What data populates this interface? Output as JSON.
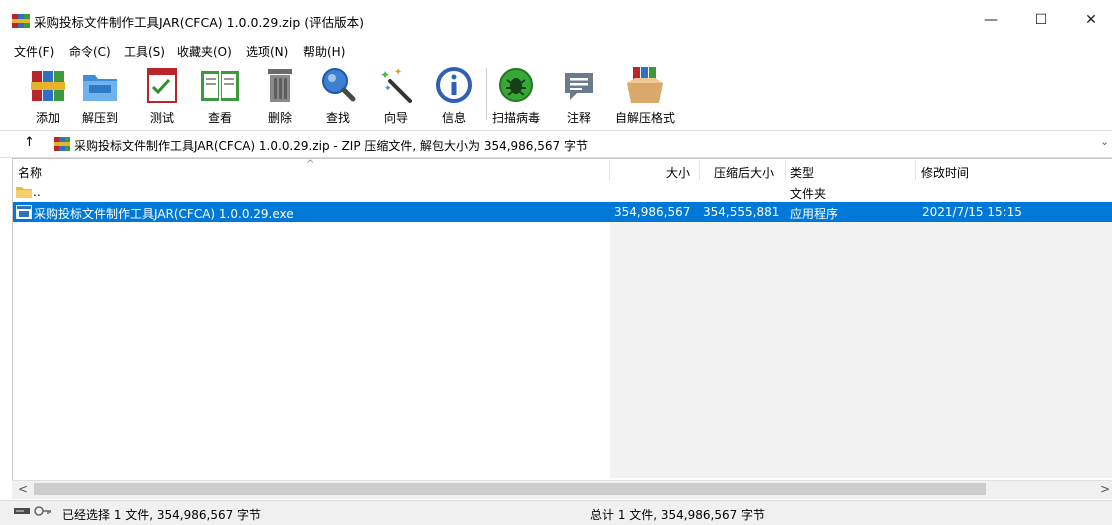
{
  "window": {
    "title": "采购投标文件制作工具JAR(CFCA) 1.0.0.29.zip (评估版本)",
    "minimize_glyph": "—",
    "maximize_glyph": "☐",
    "close_glyph": "✕"
  },
  "menu": [
    "文件(F)",
    "命令(C)",
    "工具(S)",
    "收藏夹(O)",
    "选项(N)",
    "帮助(H)"
  ],
  "toolbar": [
    {
      "label": "添加",
      "icon": "winrar-books-icon"
    },
    {
      "label": "解压到",
      "icon": "folder-icon"
    },
    {
      "label": "测试",
      "icon": "checklist-icon"
    },
    {
      "label": "查看",
      "icon": "open-book-icon"
    },
    {
      "label": "删除",
      "icon": "trash-icon"
    },
    {
      "label": "查找",
      "icon": "magnifier-icon"
    },
    {
      "label": "向导",
      "icon": "magic-wand-icon"
    },
    {
      "label": "信息",
      "icon": "info-icon"
    },
    {
      "label": "扫描病毒",
      "icon": "virus-scan-icon"
    },
    {
      "label": "注释",
      "icon": "comment-icon"
    },
    {
      "label": "自解压格式",
      "icon": "sfx-box-icon"
    }
  ],
  "address": {
    "up_glyph": "↑",
    "path": "采购投标文件制作工具JAR(CFCA) 1.0.0.29.zip - ZIP 压缩文件, 解包大小为 354,986,567 字节",
    "dropdown_glyph": "⌄"
  },
  "columns": {
    "name": "名称",
    "size": "大小",
    "packed": "压缩后大小",
    "type": "类型",
    "modified": "修改时间",
    "sort_glyph": "^"
  },
  "rows": [
    {
      "name": "..",
      "size": "",
      "packed": "",
      "type": "文件夹",
      "modified": ""
    },
    {
      "name": "采购投标文件制作工具JAR(CFCA) 1.0.0.29.exe",
      "size": "354,986,567",
      "packed": "354,555,881",
      "type": "应用程序",
      "modified": "2021/7/15 15:15"
    }
  ],
  "scrollbar": {
    "left_glyph": "<",
    "right_glyph": ">"
  },
  "status": {
    "left": "已经选择 1 文件, 354,986,567 字节",
    "right": "总计 1 文件, 354,986,567 字节"
  },
  "colors": {
    "selection": "#0078d7",
    "accent": "#0078d7"
  }
}
